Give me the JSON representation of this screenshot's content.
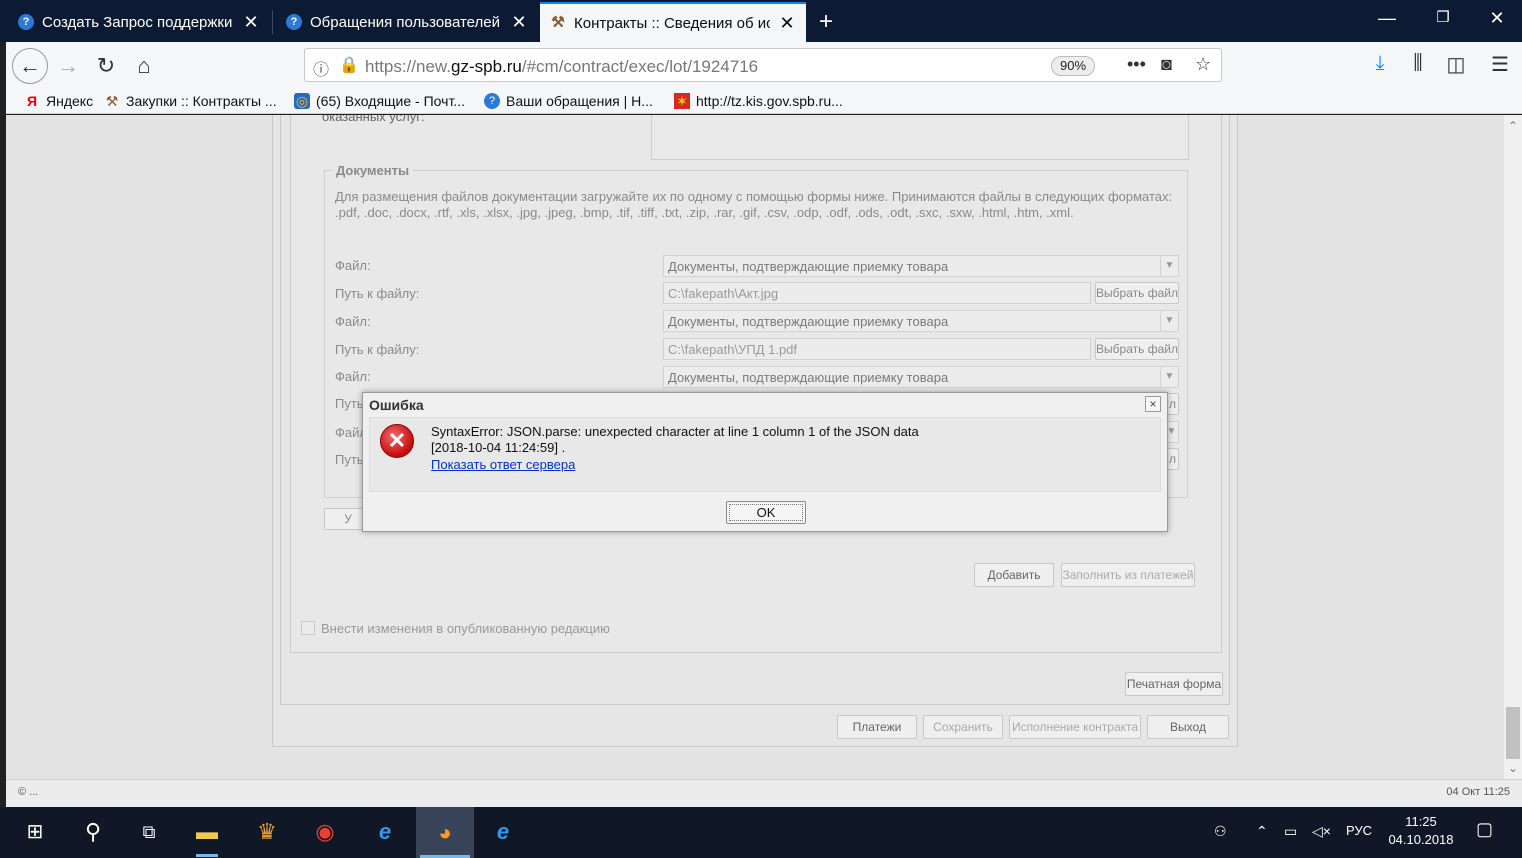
{
  "browser": {
    "tabs": [
      {
        "title": "Создать Запрос поддержки - "
      },
      {
        "title": "Обращения пользователей А"
      },
      {
        "title": "Контракты :: Сведения об исп"
      }
    ],
    "url_prefix": "https://new.",
    "url_domain": "gz-spb.ru",
    "url_suffix": "/#cm/contract/exec/lot/1924716",
    "zoom": "90%",
    "bookmarks": [
      {
        "label": "Яндекс"
      },
      {
        "label": "Закупки :: Контракты ..."
      },
      {
        "label": "(65) Входящие - Почт..."
      },
      {
        "label": "Ваши обращения | Н..."
      },
      {
        "label": "http://tz.kis.gov.spb.ru..."
      }
    ]
  },
  "form": {
    "cut_label": "оказанных услуг:",
    "documents_legend": "Документы",
    "documents_note": "Для размещения файлов документации загружайте их по одному с помощью формы ниже. Принимаются файлы в следующих форматах: .pdf, .doc, .docx, .rtf, .xls, .xlsx, .jpg, .jpeg, .bmp, .tif, .tiff, .txt, .zip, .rar, .gif, .csv, .odp, .odf, .ods, .odt, .sxc, .sxw, .html, .htm, .xml.",
    "file_label": "Файл:",
    "path_label": "Путь к файлу:",
    "path_label_partial": "Путь",
    "file_label_partial": "Файл",
    "file_type": "Документы, подтверждающие приемку товара",
    "choose_file": "Выбрать файл",
    "choose_file_partial": "л",
    "paths": [
      "C:\\fakepath\\Акт.jpg",
      "C:\\fakepath\\УПД 1.pdf"
    ],
    "delete_partial": "У",
    "add_button": "Добавить",
    "fill_from_payments": "Заполнить из платежей",
    "publish_changes": "Внести изменения в опубликованную редакцию",
    "print_form": "Печатная форма",
    "payments": "Платежи",
    "save": "Сохранить",
    "contract_execution": "Исполнение контракта",
    "exit": "Выход"
  },
  "dialog": {
    "title": "Ошибка",
    "close": "×",
    "message_line1": "SyntaxError: JSON.parse: unexpected character at line 1 column 1 of the JSON data",
    "message_line2": "[2018-10-04 11:24:59] .",
    "link": "Показать ответ сервера",
    "ok": "OK"
  },
  "status": {
    "left": "© ...",
    "right": "04 Окт 11:25"
  },
  "taskbar": {
    "lang": "РУС",
    "time": "11:25",
    "date": "04.10.2018"
  },
  "colors": {
    "tabbar": "#0c1b33",
    "active_tab_accent": "#0a84ff",
    "lock_green": "#12bc00",
    "error_red": "#c40c0c",
    "link_blue": "#0033cc",
    "taskbar": "#101827"
  }
}
